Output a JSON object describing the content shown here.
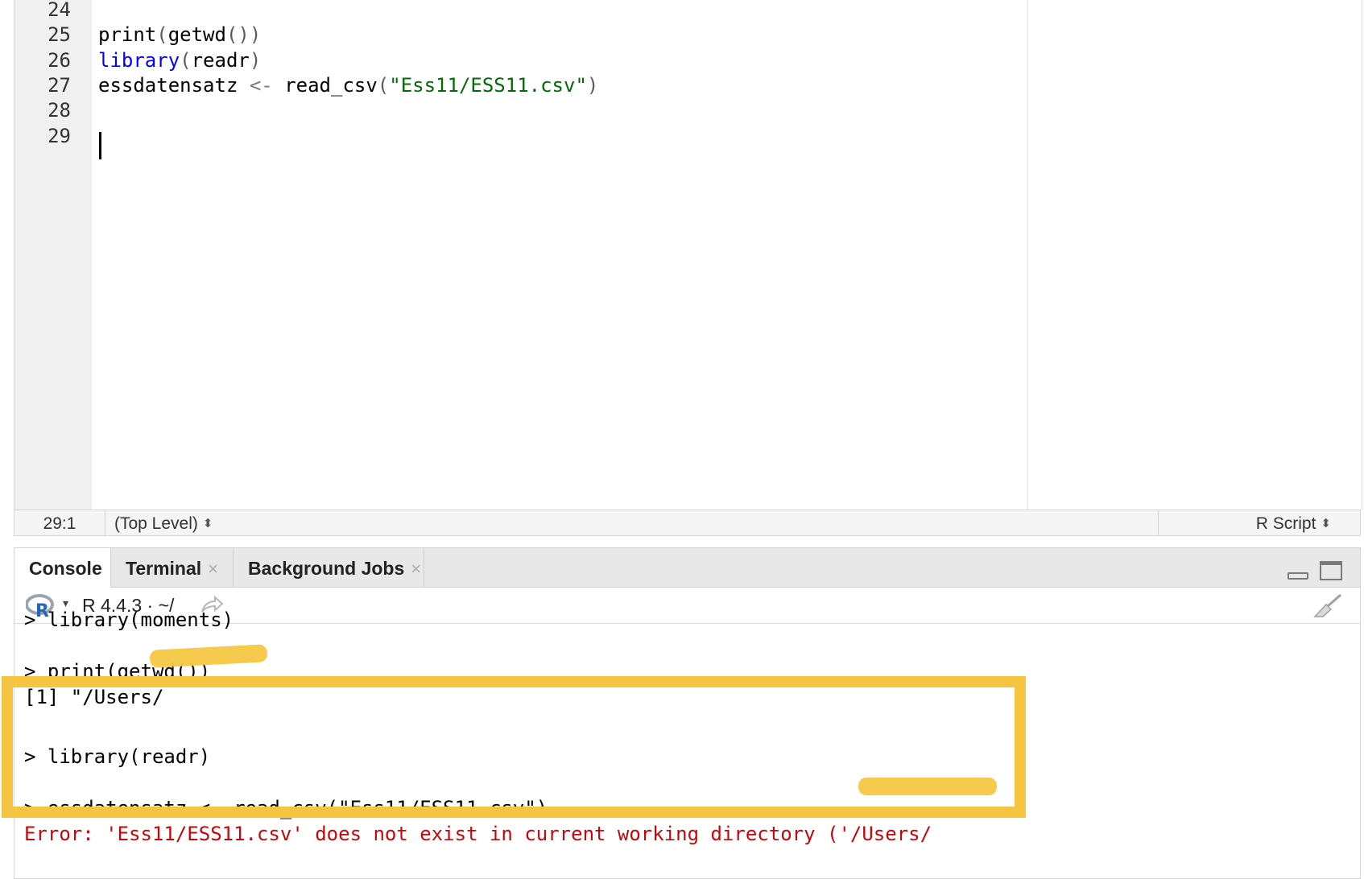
{
  "editor": {
    "lines": [
      {
        "num": "24",
        "tokens": []
      },
      {
        "num": "25",
        "tokens": [
          {
            "t": "print",
            "c": ""
          },
          {
            "t": "(",
            "c": "tok-punc"
          },
          {
            "t": "getwd",
            "c": ""
          },
          {
            "t": "())",
            "c": "tok-punc"
          }
        ]
      },
      {
        "num": "26",
        "tokens": [
          {
            "t": "library",
            "c": "tok-fn-blue"
          },
          {
            "t": "(",
            "c": "tok-punc"
          },
          {
            "t": "readr",
            "c": ""
          },
          {
            "t": ")",
            "c": "tok-punc"
          }
        ]
      },
      {
        "num": "27",
        "tokens": [
          {
            "t": "essdatensatz ",
            "c": ""
          },
          {
            "t": "<-",
            "c": "tok-op"
          },
          {
            "t": " read_csv",
            "c": ""
          },
          {
            "t": "(",
            "c": "tok-punc"
          },
          {
            "t": "\"Ess11/ESS11.csv\"",
            "c": "tok-str"
          },
          {
            "t": ")",
            "c": "tok-punc"
          }
        ]
      },
      {
        "num": "28",
        "tokens": []
      },
      {
        "num": "29",
        "tokens": []
      }
    ]
  },
  "statusbar": {
    "cursor_position": "29:1",
    "scope": "(Top Level)",
    "file_type": "R Script"
  },
  "console": {
    "tabs": [
      {
        "label": "Console",
        "closable": false
      },
      {
        "label": "Terminal",
        "closable": true
      },
      {
        "label": "Background Jobs",
        "closable": true
      }
    ],
    "close_glyph": "×",
    "r_version": "R 4.4.3",
    "working_dir": "~/",
    "dropdown_glyph": "▾",
    "output": [
      {
        "text": "> library(moments)",
        "type": "normal"
      },
      {
        "text": "",
        "type": "normal"
      },
      {
        "text": "> print(getwd())",
        "type": "normal"
      },
      {
        "text": "[1] \"/Users/",
        "type": "normal"
      },
      {
        "text": "",
        "type": "normal"
      },
      {
        "text": "> library(readr)",
        "type": "normal"
      },
      {
        "text": "",
        "type": "normal"
      },
      {
        "text": "> essdatensatz <- read_csv(\"Ess11/ESS11.csv\")",
        "type": "normal"
      },
      {
        "text": "Error: 'Ess11/ESS11.csv' does not exist in current working directory ('/Users/",
        "type": "error"
      }
    ]
  },
  "colors": {
    "highlight": "#f5c542",
    "error_text": "#c5060b",
    "string_green": "#036a07",
    "keyword_blue": "#0000ff"
  },
  "icons": [
    "r-logo-icon",
    "chevron-down-icon",
    "share-arrow-icon",
    "broom-icon",
    "minimize-icon",
    "maximize-icon",
    "close-icon",
    "updown-icon"
  ]
}
